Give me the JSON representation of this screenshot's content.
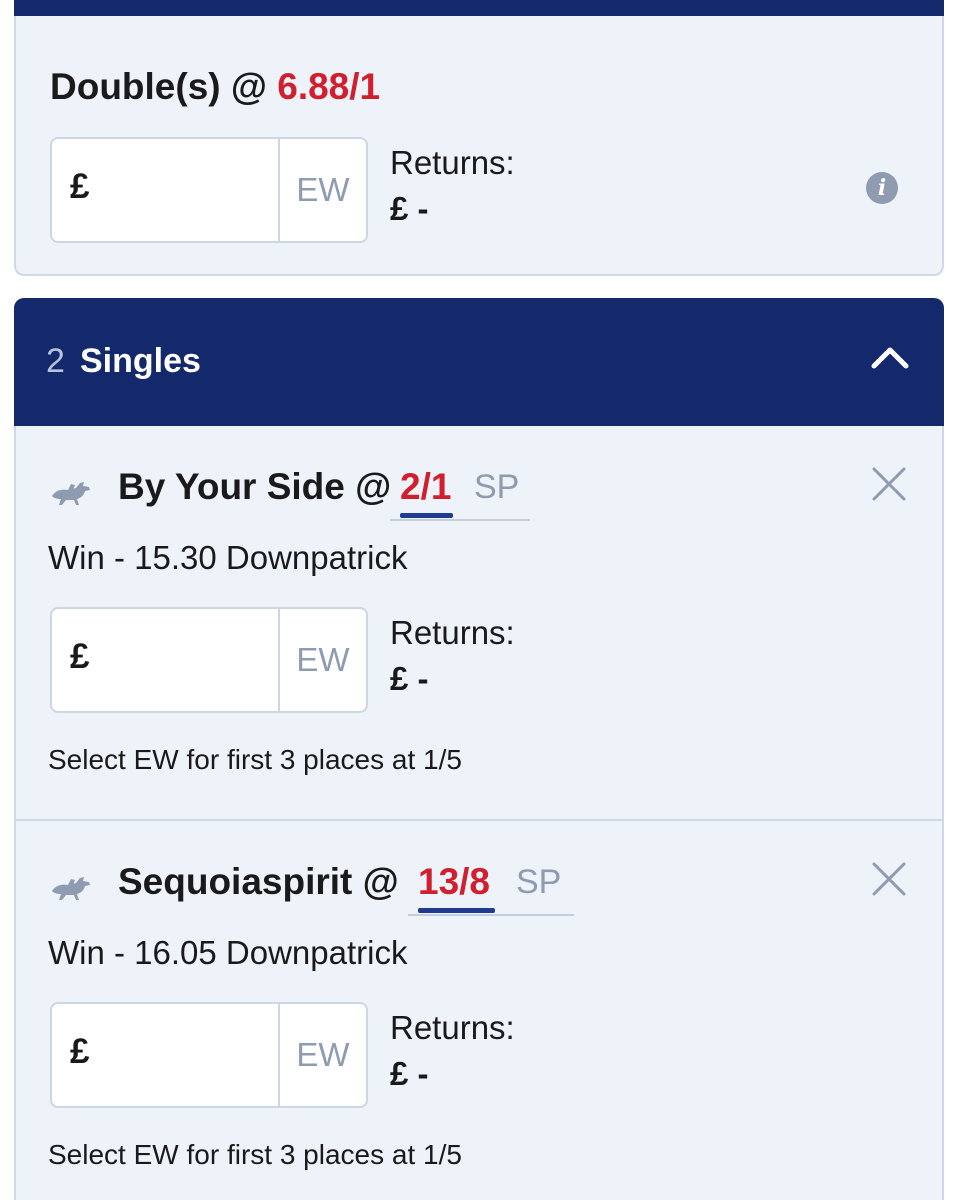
{
  "multiple": {
    "title": "Double(s) @",
    "odds": "6.88/1",
    "stake_currency": "£",
    "ew_label": "EW",
    "returns_label": "Returns:",
    "returns_value": "£ -"
  },
  "singles": {
    "count": "2",
    "label": "Singles",
    "selections": [
      {
        "name": "By Your Side @",
        "odds": "2/1",
        "sp_label": "SP",
        "market": "Win - 15.30 Downpatrick",
        "stake_currency": "£",
        "ew_label": "EW",
        "returns_label": "Returns:",
        "returns_value": "£ -",
        "ew_terms": "Select EW for first 3 places at 1/5"
      },
      {
        "name": "Sequoiaspirit @",
        "odds": "13/8",
        "sp_label": "SP",
        "market": "Win - 16.05 Downpatrick",
        "stake_currency": "£",
        "ew_label": "EW",
        "returns_label": "Returns:",
        "returns_value": "£ -",
        "ew_terms": "Select EW for first 3 places at 1/5"
      }
    ]
  },
  "colors": {
    "navy": "#13296b",
    "odds_red": "#d01f2f",
    "card_bg": "#eef3fa",
    "muted": "#8e9bb0"
  },
  "icons": {
    "info": "info-icon",
    "collapse": "chevron-up-icon",
    "remove": "close-icon",
    "sport": "horse-racing-icon"
  }
}
